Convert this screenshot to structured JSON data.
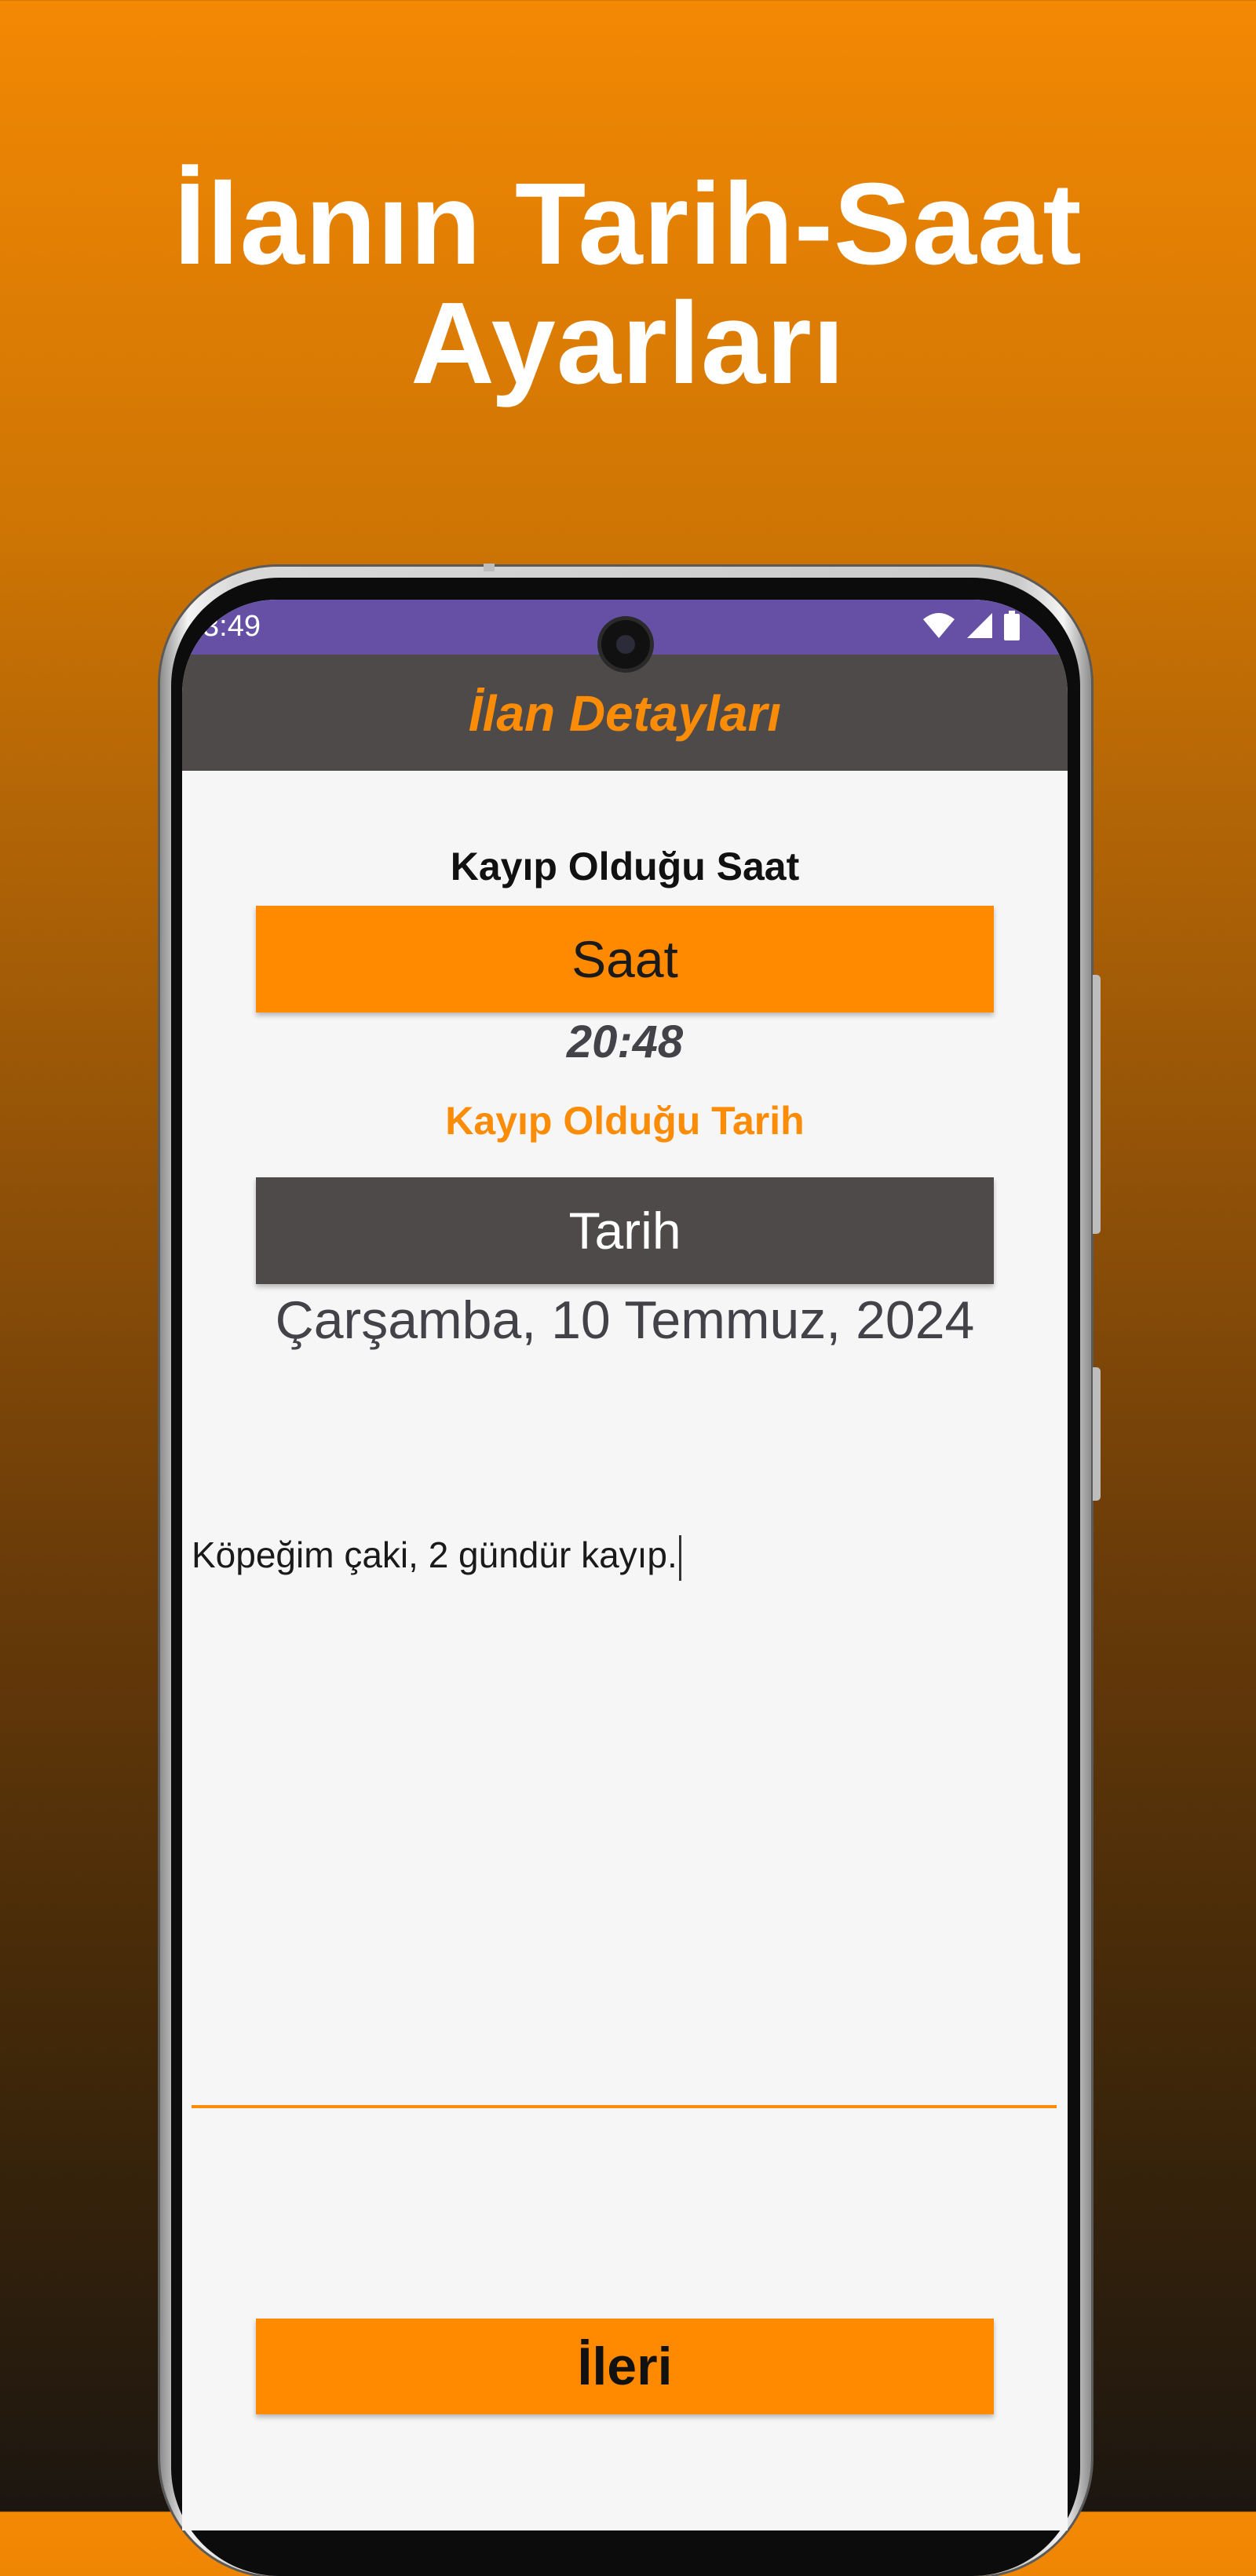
{
  "headline": {
    "line1": "İlanın Tarih-Saat",
    "line2": "Ayarları"
  },
  "status_bar": {
    "time": "3:49",
    "icons": [
      "wifi-icon",
      "signal-icon",
      "battery-icon"
    ]
  },
  "app_bar": {
    "title": "İlan Detayları"
  },
  "form": {
    "time_label": "Kayıp Olduğu Saat",
    "time_button": "Saat",
    "time_value": "20:48",
    "date_label": "Kayıp Olduğu Tarih",
    "date_button": "Tarih",
    "date_value": "Çarşamba, 10 Temmuz, 2024",
    "description_value": "Köpeğim çaki, 2 gündür kayıp."
  },
  "footer": {
    "next_button": "İleri"
  },
  "colors": {
    "accent": "#ff8a00",
    "app_bar": "#4e4a49",
    "status_bar": "#6650a6",
    "screen_bg": "#f6f6f6"
  }
}
